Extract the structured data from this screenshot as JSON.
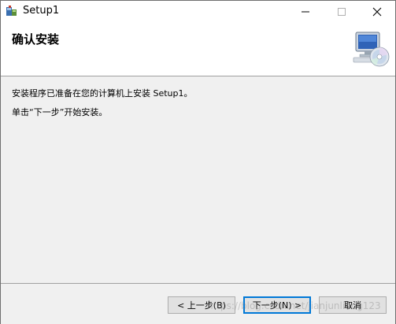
{
  "window": {
    "title": "Setup1"
  },
  "banner": {
    "title": "确认安装",
    "image_icon": "computer-cd-icon"
  },
  "content": {
    "line1": "安装程序已准备在您的计算机上安装 Setup1。",
    "line2": "单击“下一步”开始安装。"
  },
  "buttons": {
    "back": "< 上一步(B)",
    "next": "下一步(N) >",
    "cancel": "取消"
  },
  "watermark": "https://blog.csdn.net/jianjunliang123",
  "colors": {
    "banner_bg": "#ffffff",
    "body_bg": "#f0f0f0",
    "focus_border": "#0078d7"
  }
}
